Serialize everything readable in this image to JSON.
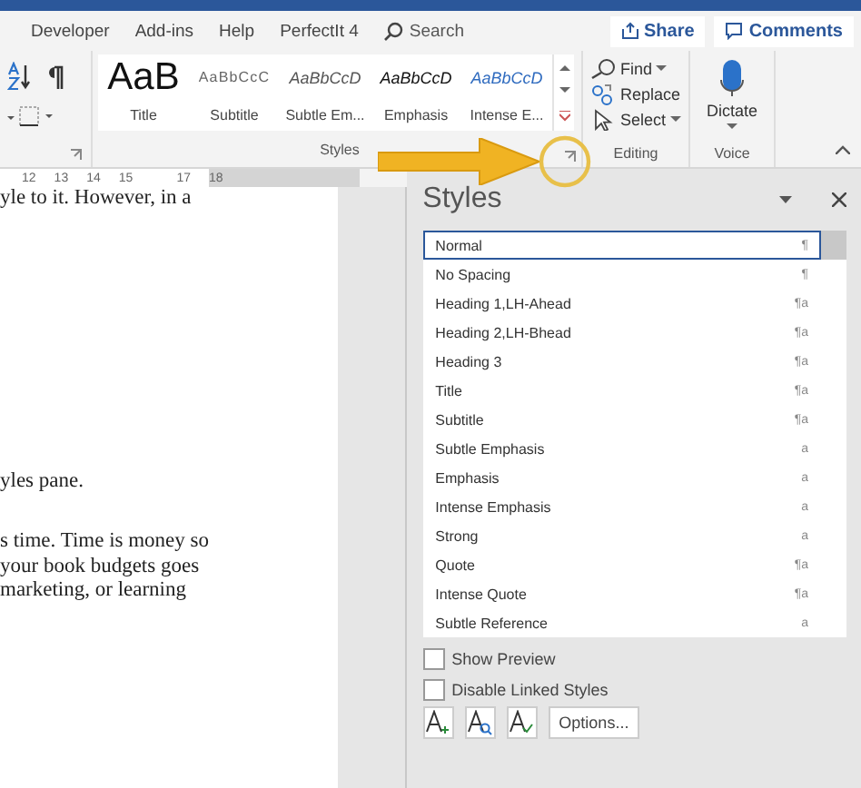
{
  "ribbon_tabs": [
    {
      "label": "Developer"
    },
    {
      "label": "Add-ins"
    },
    {
      "label": "Help"
    },
    {
      "label": "PerfectIt 4"
    }
  ],
  "search": {
    "placeholder": "Search"
  },
  "share_button": "Share",
  "comments_button": "Comments",
  "gallery": [
    {
      "preview": "AaB",
      "name": "Title",
      "kind": "title"
    },
    {
      "preview": "AaBbCcC",
      "name": "Subtitle",
      "kind": "subtitle"
    },
    {
      "preview": "AaBbCcD",
      "name": "Subtle Em...",
      "kind": "subtle"
    },
    {
      "preview": "AaBbCcD",
      "name": "Emphasis",
      "kind": "emphasis"
    },
    {
      "preview": "AaBbCcD",
      "name": "Intense E...",
      "kind": "intense"
    }
  ],
  "styles_group_label": "Styles",
  "editing": {
    "items": [
      {
        "label": "Find",
        "kind": "find"
      },
      {
        "label": "Replace",
        "kind": "replace"
      },
      {
        "label": "Select",
        "kind": "select"
      }
    ],
    "label": "Editing"
  },
  "voice": {
    "button": "Dictate",
    "label": "Voice"
  },
  "ruler": {
    "ticks": [
      "12",
      "13",
      "14",
      "15",
      "17",
      "18"
    ]
  },
  "document": {
    "paragraphs": [
      [
        "yle to it. However, in a"
      ],
      [
        "yles pane."
      ],
      [
        "s time. Time is money so",
        "your book budgets goes",
        "marketing, or learning"
      ]
    ]
  },
  "styles_pane": {
    "title": "Styles",
    "styles": [
      {
        "name": "Normal",
        "mark": "¶",
        "selected": true
      },
      {
        "name": "No Spacing",
        "mark": "¶",
        "selected": false
      },
      {
        "name": "Heading 1,LH-Ahead",
        "mark": "¶a",
        "selected": false
      },
      {
        "name": "Heading 2,LH-Bhead",
        "mark": "¶a",
        "selected": false
      },
      {
        "name": "Heading 3",
        "mark": "¶a",
        "selected": false
      },
      {
        "name": "Title",
        "mark": "¶a",
        "selected": false
      },
      {
        "name": "Subtitle",
        "mark": "¶a",
        "selected": false
      },
      {
        "name": "Subtle Emphasis",
        "mark": "a",
        "selected": false
      },
      {
        "name": "Emphasis",
        "mark": "a",
        "selected": false
      },
      {
        "name": "Intense Emphasis",
        "mark": "a",
        "selected": false
      },
      {
        "name": "Strong",
        "mark": "a",
        "selected": false
      },
      {
        "name": "Quote",
        "mark": "¶a",
        "selected": false
      },
      {
        "name": "Intense Quote",
        "mark": "¶a",
        "selected": false
      },
      {
        "name": "Subtle Reference",
        "mark": "a",
        "selected": false
      }
    ],
    "options": [
      {
        "label": "Show Preview",
        "checked": false
      },
      {
        "label": "Disable Linked Styles",
        "checked": false
      }
    ],
    "options_button": "Options..."
  }
}
